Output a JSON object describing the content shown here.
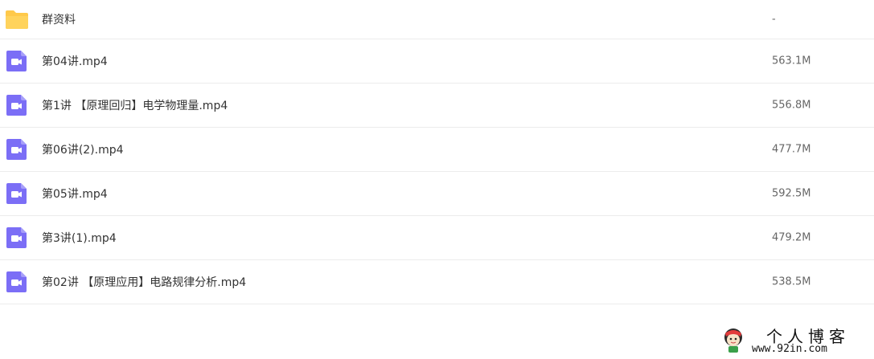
{
  "files": [
    {
      "name": "群资料",
      "size": "-",
      "type": "folder-icon"
    },
    {
      "name": "第04讲.mp4",
      "size": "563.1M",
      "type": "video-file-icon"
    },
    {
      "name": "第1讲 【原理回归】电学物理量.mp4",
      "size": "556.8M",
      "type": "video-file-icon"
    },
    {
      "name": "第06讲(2).mp4",
      "size": "477.7M",
      "type": "video-file-icon"
    },
    {
      "name": "第05讲.mp4",
      "size": "592.5M",
      "type": "video-file-icon"
    },
    {
      "name": "第3讲(1).mp4",
      "size": "479.2M",
      "type": "video-file-icon"
    },
    {
      "name": "第02讲 【原理应用】电路规律分析.mp4",
      "size": "538.5M",
      "type": "video-file-icon"
    }
  ],
  "colors": {
    "folder": "#ffc94a",
    "video": "#7b6ef6",
    "divider": "#ececec"
  },
  "watermark": {
    "title": "个人博客",
    "url": "www.92in.com"
  }
}
